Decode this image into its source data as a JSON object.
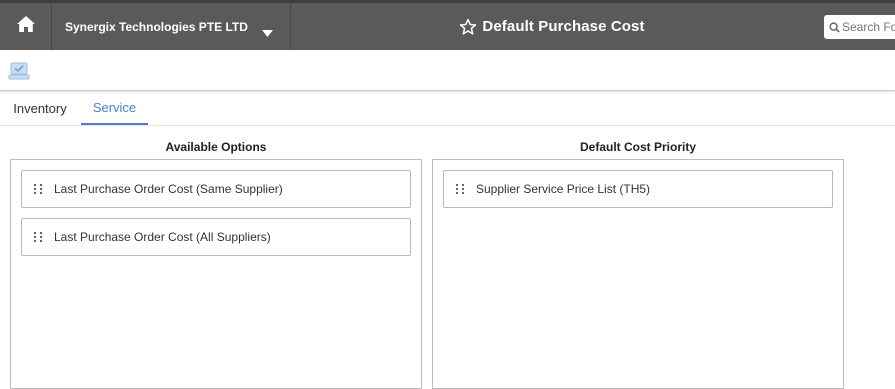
{
  "header": {
    "home_icon": "home-icon",
    "company": "Synergix Technologies PTE LTD",
    "company_caret_icon": "caret-down-icon",
    "title": "Default Purchase Cost",
    "title_icon": "star-outline-icon",
    "search_icon": "search-icon",
    "search_placeholder": "Search For"
  },
  "toolbar": {
    "save_icon": "save-icon"
  },
  "tabs": [
    {
      "label": "Inventory",
      "active": false
    },
    {
      "label": "Service",
      "active": true
    }
  ],
  "available_options": {
    "title": "Available Options",
    "items": [
      {
        "label": "Last Purchase Order Cost (Same Supplier)"
      },
      {
        "label": "Last Purchase Order Cost (All Suppliers)"
      }
    ]
  },
  "default_cost_priority": {
    "title": "Default Cost Priority",
    "items": [
      {
        "label": "Supplier Service Price List (TH5)"
      }
    ]
  },
  "colors": {
    "topbar": "#5a5a5a",
    "accent": "#4a7fd4"
  }
}
